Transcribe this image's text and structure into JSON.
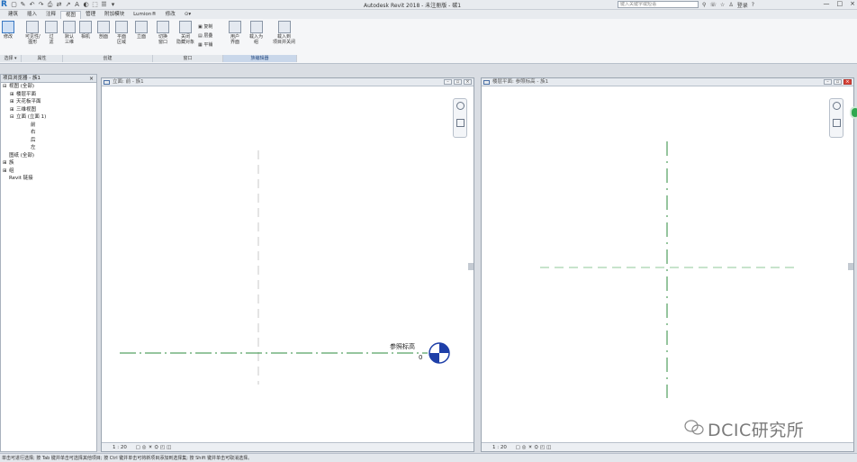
{
  "window": {
    "app_title": "Autodesk Revit 2018 - 未注册版 - 碳1",
    "search_placeholder": "键入关键字或短语",
    "login_label": "登录",
    "controls": [
      "—",
      "□",
      "×"
    ]
  },
  "quick_access": [
    "▢",
    "✎",
    "↶",
    "↷",
    "⎙",
    "⇄",
    "↗",
    "A",
    "◐",
    "⬚",
    "☰",
    "▾"
  ],
  "tabs": [
    "建筑",
    "插入",
    "注释",
    "视图",
    "管理",
    "附加模块",
    "Lumion®",
    "修改",
    "⊙▾"
  ],
  "active_tab": "视图",
  "ribbon": {
    "buttons": [
      {
        "label": "修改",
        "sub": "",
        "active": true
      },
      {
        "label": "可见性/",
        "sub": "图形",
        "active": false
      },
      {
        "label": "过",
        "sub": "滤",
        "active": false
      },
      {
        "label": "默认",
        "sub": "三维",
        "active": false
      },
      {
        "label": "相机",
        "sub": "",
        "active": false
      },
      {
        "label": "剖面",
        "sub": "",
        "active": false
      },
      {
        "label": "平面",
        "sub": "区域",
        "active": false
      },
      {
        "label": "立面",
        "sub": "",
        "active": false
      },
      {
        "label": "切换",
        "sub": "窗口",
        "active": false
      },
      {
        "label": "关闭",
        "sub": "隐藏对象",
        "active": false
      },
      {
        "label": "用户",
        "sub": "界面",
        "active": false
      },
      {
        "label": "载入为",
        "sub": "组",
        "active": false
      },
      {
        "label": "载入到",
        "sub": "项目并关闭",
        "active": false
      }
    ],
    "small_items": [
      "复制",
      "层叠",
      "平铺"
    ],
    "panels": [
      "选择 ▾",
      "属性",
      "创建",
      "窗口",
      "族编辑器"
    ]
  },
  "browser": {
    "title": "项目浏览器 - 族1",
    "items": [
      {
        "text": "视图 (全部)",
        "expander": "⊟",
        "indent": 0
      },
      {
        "text": "楼层平面",
        "expander": "⊞",
        "indent": 1
      },
      {
        "text": "天花板平面",
        "expander": "⊞",
        "indent": 1
      },
      {
        "text": "三维视图",
        "expander": "⊞",
        "indent": 1
      },
      {
        "text": "立面 (立面 1)",
        "expander": "⊟",
        "indent": 1
      },
      {
        "text": "前",
        "expander": "",
        "indent": 3
      },
      {
        "text": "右",
        "expander": "",
        "indent": 3
      },
      {
        "text": "后",
        "expander": "",
        "indent": 3
      },
      {
        "text": "左",
        "expander": "",
        "indent": 3
      },
      {
        "text": "图纸 (全部)",
        "expander": "",
        "indent": 0
      },
      {
        "text": "族",
        "expander": "⊞",
        "indent": 0
      },
      {
        "text": "组",
        "expander": "⊞",
        "indent": 0
      },
      {
        "text": "Revit 链接",
        "expander": "",
        "indent": 0
      }
    ]
  },
  "left_view": {
    "title": "立面: 前 - 族1",
    "scale": "1 : 20",
    "level_name": "参照标高",
    "level_value": "0"
  },
  "right_view": {
    "title": "楼层平面: 参照标高 - 族1",
    "scale": "1 : 20"
  },
  "status_text": "单击可进行选择; 按 Tab 键并单击可选择其他项目; 按 Ctrl 键并单击可将新项目添加到选择集; 按 Shift 键并单击可取消选择。",
  "watermark": "DCIC研究所",
  "colors": {
    "reference_plane": "#2e8b3d",
    "level_marker_blue": "#1e3fa8",
    "active_button": "#3a78c2"
  }
}
